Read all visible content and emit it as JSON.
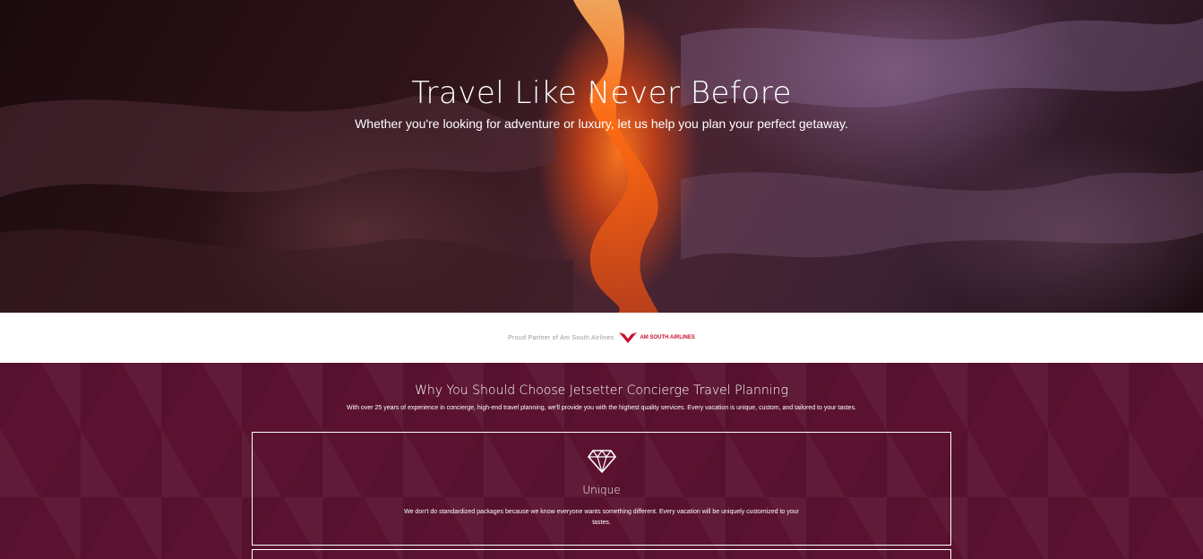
{
  "hero": {
    "title": "Travel Like Never Before",
    "subtitle": "Whether you're looking for adventure or luxury, let us help you plan your perfect getaway."
  },
  "partner": {
    "text": "Proud Partner of Am South Airlines",
    "logo_text": "AM SOUTH AIRLINES",
    "logo_icon": "airline-chevron-logo"
  },
  "why": {
    "title": "Why You Should Choose Jetsetter Concierge Travel Planning",
    "text": "With over 25 years of experience in concierge, high-end travel planning, we'll provide you with the highest quality services. Every vacation is unique, custom, and tailored to your tastes.",
    "features": [
      {
        "icon": "diamond-icon",
        "title": "Unique",
        "text": "We don't do standardized packages because we know everyone wants something different. Every vacation will be uniquely customized to your tastes."
      }
    ]
  },
  "colors": {
    "section_bg": "#5a1230",
    "accent": "#c8102e",
    "canyon_orange": "#ff7a1e"
  }
}
